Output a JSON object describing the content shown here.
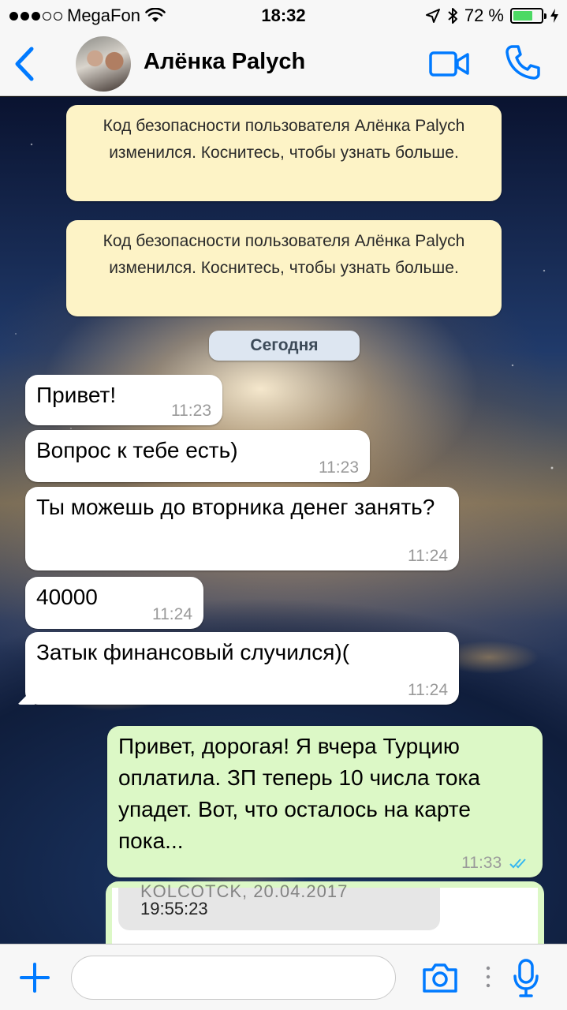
{
  "status_bar": {
    "carrier": "MegaFon",
    "time": "18:32",
    "battery_percent": "72 %",
    "battery_level": 0.72,
    "icons": [
      "signal-dots-icon",
      "wifi-icon",
      "location-arrow-icon",
      "bluetooth-icon",
      "battery-icon",
      "charging-bolt-icon"
    ]
  },
  "header": {
    "contact_name": "Алёнка Palych",
    "icons": [
      "back-chevron-icon",
      "video-call-icon",
      "phone-call-icon"
    ],
    "accent_color": "#007aff"
  },
  "chat": {
    "system_notices": [
      {
        "text": "Код безопасности пользователя Алёнка Palych изменился. Коснитесь, чтобы узнать больше."
      },
      {
        "text": "Код безопасности пользователя Алёнка Palych изменился. Коснитесь, чтобы узнать больше."
      }
    ],
    "date_divider": "Сегодня",
    "messages": [
      {
        "direction": "in",
        "text": "Привет!",
        "time": "11:23"
      },
      {
        "direction": "in",
        "text": "Вопрос к тебе есть)",
        "time": "11:23"
      },
      {
        "direction": "in",
        "text": "Ты можешь до вторника денег занять?",
        "time": "11:24"
      },
      {
        "direction": "in",
        "text": "40000",
        "time": "11:24"
      },
      {
        "direction": "in",
        "text": "Затык финансовый случился)(",
        "time": "11:24"
      },
      {
        "direction": "out",
        "text": "Привет, дорогая! Я вчера Турцию оплатила. ЗП теперь 10 числа тока упадет. Вот, что осталось на карте пока...",
        "time": "11:33",
        "status": "read-double-check-icon"
      }
    ],
    "image_message": {
      "partial_line": "KOLCOTCK, 20.04.2017",
      "visible_line": "19:55:23"
    },
    "colors": {
      "incoming": "#ffffff",
      "outgoing": "#dcf8c6",
      "notice": "#fdf3c6",
      "read_ticks": "#34b7f1"
    }
  },
  "input_bar": {
    "message_value": "",
    "icons": [
      "plus-icon",
      "camera-icon",
      "more-dots-icon",
      "microphone-icon"
    ]
  }
}
